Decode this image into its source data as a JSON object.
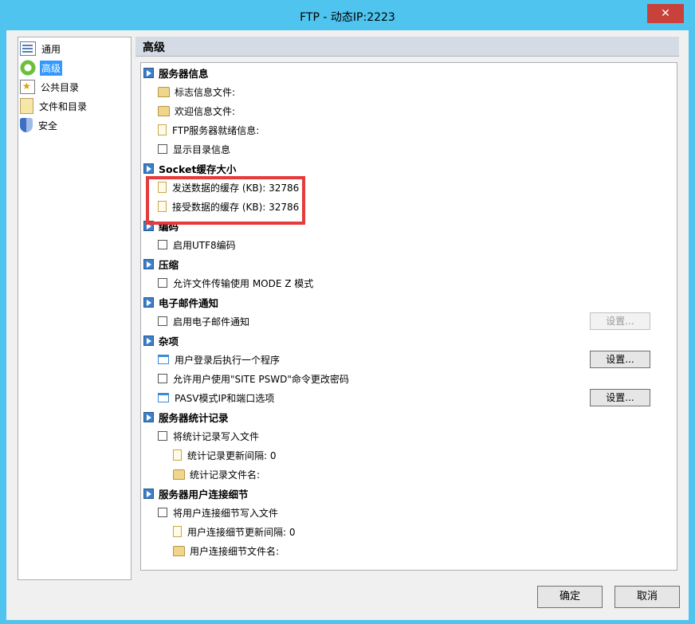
{
  "window": {
    "title": "FTP - 动态IP:2223",
    "close_label": "✕"
  },
  "nav": {
    "items": [
      {
        "label": "通用"
      },
      {
        "label": "高级"
      },
      {
        "label": "公共目录"
      },
      {
        "label": "文件和目录"
      },
      {
        "label": "安全"
      }
    ]
  },
  "section": {
    "title": "高级"
  },
  "tree": {
    "server_info": {
      "header": "服务器信息",
      "banner_file": "标志信息文件:",
      "welcome_file": "欢迎信息文件:",
      "ready_msg": "FTP服务器就绪信息:",
      "show_dir_info": "显示目录信息"
    },
    "socket": {
      "header": "Socket缓存大小",
      "send_buffer": "发送数据的缓存 (KB): 32786",
      "recv_buffer": "接受数据的缓存 (KB): 32786"
    },
    "encoding": {
      "header": "编码",
      "utf8": "启用UTF8编码"
    },
    "compression": {
      "header": "压缩",
      "mode_z": "允许文件传输使用 MODE Z 模式"
    },
    "email": {
      "header": "电子邮件通知",
      "enable": "启用电子邮件通知",
      "settings_btn": "设置..."
    },
    "misc": {
      "header": "杂项",
      "run_program": "用户登录后执行一个程序",
      "run_program_btn": "设置...",
      "site_pswd": "允许用户使用\"SITE PSWD\"命令更改密码",
      "pasv": "PASV模式IP和端口选项",
      "pasv_btn": "设置..."
    },
    "stats": {
      "header": "服务器统计记录",
      "write_file": "将统计记录写入文件",
      "interval": "统计记录更新间隔: 0",
      "filename": "统计记录文件名:"
    },
    "conn_details": {
      "header": "服务器用户连接细节",
      "write_file": "将用户连接细节写入文件",
      "interval": "用户连接细节更新间隔: 0",
      "filename": "用户连接细节文件名:"
    }
  },
  "footer": {
    "ok": "确定",
    "cancel": "取消"
  },
  "colors": {
    "title_bar": "#4fc4ee",
    "highlight_box": "#e53b3b",
    "selection": "#3399ff"
  }
}
